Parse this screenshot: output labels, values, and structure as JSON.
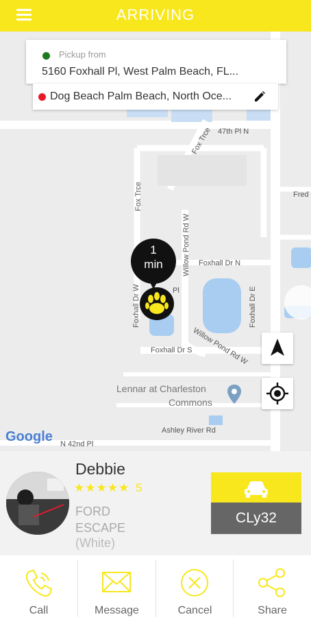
{
  "header": {
    "title": "ARRIVING"
  },
  "trip": {
    "pickup_label": "Pickup from",
    "pickup_address": "5160 Foxhall Pl,  West Palm Beach,  FL...",
    "destination_address": "Dog Beach Palm Beach, North Oce..."
  },
  "map": {
    "eta_value": "1",
    "eta_unit": "min",
    "streets": [
      "47th Pl N",
      "Fox Trce",
      "Fred",
      "Fox Trce",
      "Willow Pond Rd W",
      "Foxhall Dr N",
      "Foxhall Dr W",
      "Pl",
      "Foxhall Dr E",
      "Willow Pond Rd W",
      "Foxhall Dr S",
      "Lennar at Charleston",
      "Commons",
      "Ashley River Rd",
      "N 42nd Pl"
    ],
    "attribution": "Google"
  },
  "driver": {
    "name": "Debbie",
    "stars": "★★★★★",
    "rating": "5",
    "car_model": "FORD ESCAPE",
    "car_color": "(White)",
    "plate": "CLy32"
  },
  "actions": {
    "call": "Call",
    "message": "Message",
    "cancel": "Cancel",
    "share": "Share"
  },
  "colors": {
    "accent": "#f8e71c",
    "pickup_dot": "#1f7a1f",
    "dest_dot": "#e8192c",
    "plate_bg": "#666666"
  }
}
